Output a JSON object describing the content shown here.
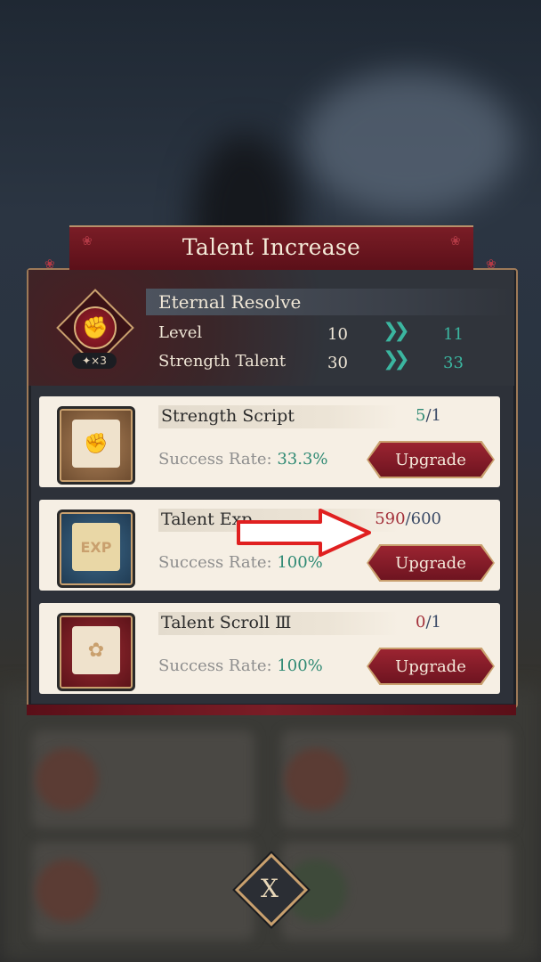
{
  "dialog": {
    "title": "Talent Increase",
    "skill": {
      "name": "Eternal Resolve",
      "icon": "fist-icon",
      "stars": "✦×3",
      "stats": [
        {
          "label": "Level",
          "from": "10",
          "to": "11"
        },
        {
          "label": "Strength Talent",
          "from": "30",
          "to": "33"
        }
      ]
    },
    "items": [
      {
        "name": "Strength Script",
        "have": "5",
        "need": "1",
        "have_color": "#2f8a74",
        "rate_label": "Success Rate:",
        "rate": "33.3%",
        "button": "Upgrade",
        "icon": "strength-script-icon"
      },
      {
        "name": "Talent Exp",
        "have": "590",
        "need": "600",
        "have_color": "#a3303a",
        "rate_label": "Success Rate:",
        "rate": "100%",
        "button": "Upgrade",
        "icon": "exp-scroll-icon"
      },
      {
        "name": "Talent Scroll Ⅲ",
        "have": "0",
        "need": "1",
        "have_color": "#a3303a",
        "rate_label": "Success Rate:",
        "rate": "100%",
        "button": "Upgrade",
        "icon": "talent-scroll-icon"
      }
    ],
    "close_label": "X"
  },
  "colors": {
    "accent_teal": "#3bb6a0",
    "header_red": "#7a1d26",
    "gold_border": "#c9a06e",
    "annotation_arrow": "#e02020"
  }
}
